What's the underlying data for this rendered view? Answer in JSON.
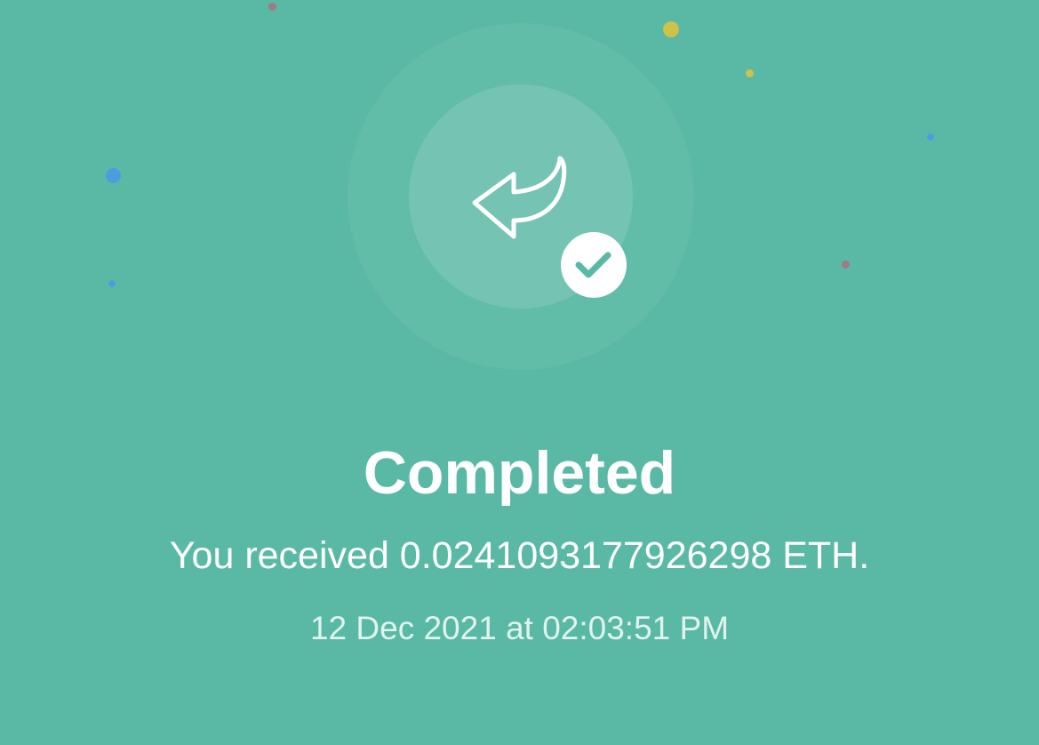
{
  "colors": {
    "background": "#5ab9a5",
    "halo_outer": "rgba(255,255,255,0.045)",
    "halo_inner": "rgba(255,255,255,0.13)",
    "icon": "#ffffff",
    "check_mark": "#5ab9a5",
    "confetti_blue": "#4a9ee0",
    "confetti_yellow": "#cdc24a",
    "confetti_mauve": "#a07a84"
  },
  "status": {
    "icon": "receive-arrow-icon",
    "badge_icon": "check-icon",
    "title": "Completed",
    "message": "You received 0.0241093177926298 ETH.",
    "timestamp": "12 Dec 2021 at 02:03:51 PM"
  }
}
